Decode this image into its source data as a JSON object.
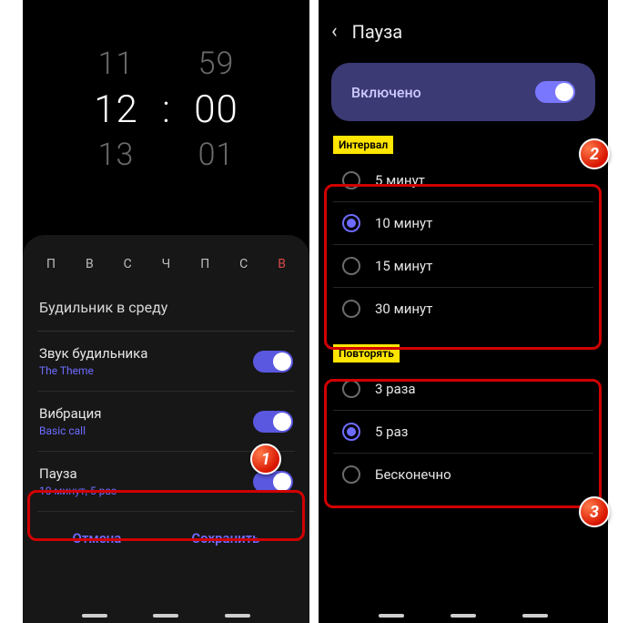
{
  "left": {
    "picker": {
      "prev_h": "11",
      "prev_m": "59",
      "sel_h": "12",
      "sel_m": "00",
      "next_h": "13",
      "next_m": "01",
      "colon": ":"
    },
    "days": [
      "П",
      "В",
      "С",
      "Ч",
      "П",
      "С",
      "В"
    ],
    "alarm_name": "Будильник в среду",
    "options": {
      "sound": {
        "title": "Звук будильника",
        "sub": "The Theme"
      },
      "vibration": {
        "title": "Вибрация",
        "sub": "Basic call"
      },
      "snooze": {
        "title": "Пауза",
        "sub": "10 минут, 5 раз"
      }
    },
    "buttons": {
      "cancel": "Отмена",
      "save": "Сохранить"
    }
  },
  "right": {
    "title": "Пауза",
    "enabled_label": "Включено",
    "section_interval": "Интервал",
    "interval_options": [
      "5 минут",
      "10 минут",
      "15 минут",
      "30 минут"
    ],
    "interval_selected": 1,
    "section_repeat": "Повторять",
    "repeat_options": [
      "3 раза",
      "5 раз",
      "Бесконечно"
    ],
    "repeat_selected": 1
  },
  "callouts": {
    "b1": "1",
    "b2": "2",
    "b3": "3"
  }
}
